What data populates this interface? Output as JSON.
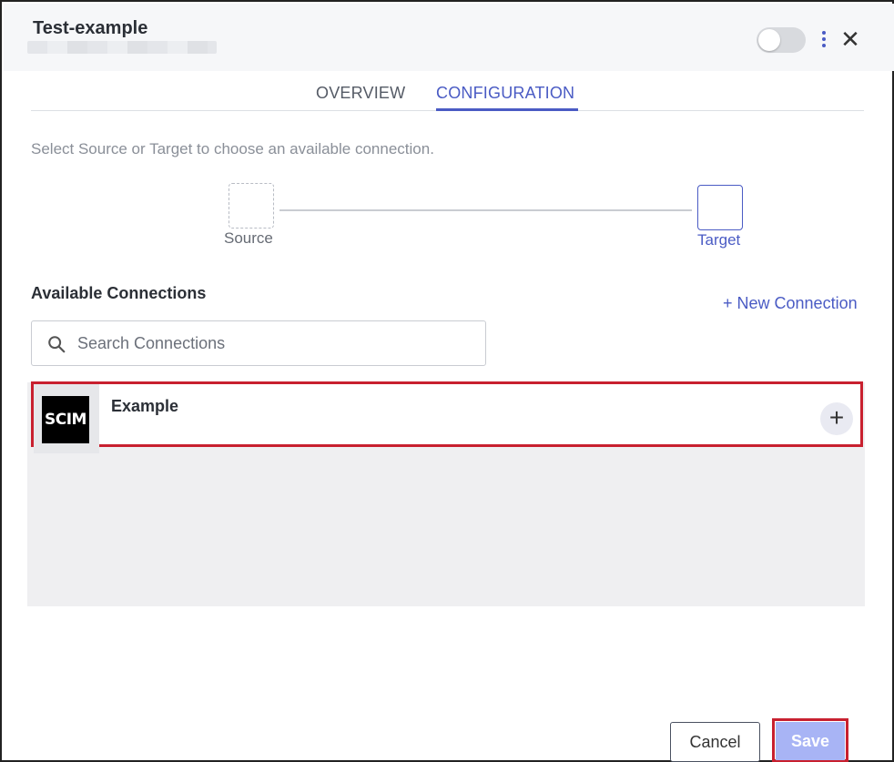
{
  "header": {
    "title": "Test-example",
    "toggle_on": false
  },
  "tabs": [
    {
      "label": "OVERVIEW",
      "active": false
    },
    {
      "label": "CONFIGURATION",
      "active": true
    }
  ],
  "configuration": {
    "instruction": "Select Source or Target to choose an available connection.",
    "source_label": "Source",
    "target_label": "Target"
  },
  "connections": {
    "section_title": "Available Connections",
    "new_connection_label": "+ New Connection",
    "search_placeholder": "Search Connections",
    "search_value": "",
    "items": [
      {
        "name": "Example",
        "logo_text": "SCIM",
        "add_symbol": "+"
      }
    ]
  },
  "footer": {
    "cancel_label": "Cancel",
    "save_label": "Save"
  },
  "colors": {
    "accent": "#4a5bc4",
    "highlight": "#c8202f",
    "save_disabled": "#a8b4f5"
  },
  "icons": {
    "search": "search-icon",
    "more": "kebab-menu-icon",
    "close": "close-icon",
    "add": "plus-icon"
  }
}
